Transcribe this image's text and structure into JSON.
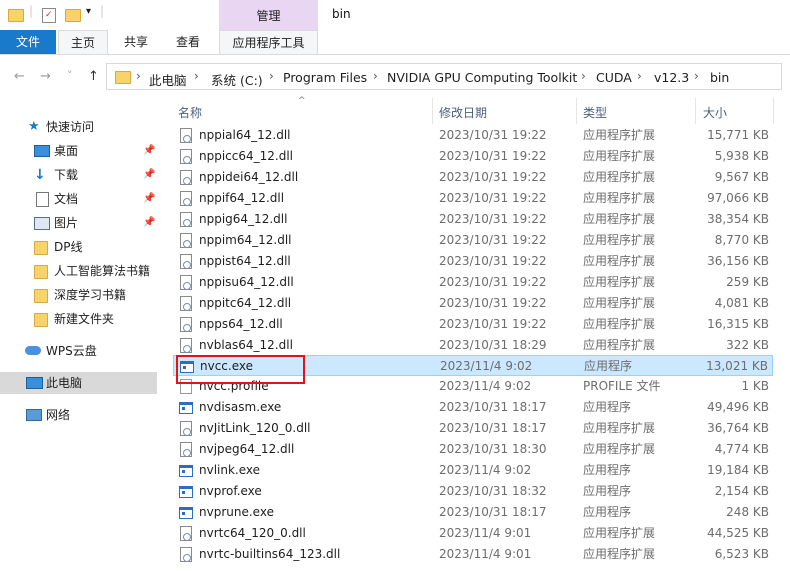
{
  "window": {
    "title": "bin"
  },
  "ribbon": {
    "context_tab": "管理",
    "tabs": {
      "file": "文件",
      "home": "主页",
      "share": "共享",
      "view": "查看",
      "app_tools": "应用程序工具"
    }
  },
  "nav": {
    "back": "←",
    "forward": "→",
    "recent": "˅",
    "up": "↑",
    "breadcrumbs": [
      "此电脑",
      "系统 (C:)",
      "Program Files",
      "NVIDIA GPU Computing Toolkit",
      "CUDA",
      "v12.3",
      "bin"
    ],
    "separator": "›"
  },
  "sidebar": {
    "quick_access": "快速访问",
    "items": [
      {
        "label": "桌面",
        "pinned": true
      },
      {
        "label": "下载",
        "pinned": true
      },
      {
        "label": "文档",
        "pinned": true
      },
      {
        "label": "图片",
        "pinned": true
      },
      {
        "label": "DP线",
        "pinned": false
      },
      {
        "label": "人工智能算法书籍",
        "pinned": false
      },
      {
        "label": "深度学习书籍",
        "pinned": false
      },
      {
        "label": "新建文件夹",
        "pinned": false
      }
    ],
    "wps": "WPS云盘",
    "this_pc": "此电脑",
    "network": "网络",
    "pin_glyph": "📌"
  },
  "columns": {
    "name": "名称",
    "date": "修改日期",
    "type": "类型",
    "size": "大小",
    "sort_glyph": "^"
  },
  "files": [
    {
      "name": "nppial64_12.dll",
      "date": "2023/10/31 19:22",
      "type": "应用程序扩展",
      "size": "15,771 KB",
      "icon": "dll"
    },
    {
      "name": "nppicc64_12.dll",
      "date": "2023/10/31 19:22",
      "type": "应用程序扩展",
      "size": "5,938 KB",
      "icon": "dll"
    },
    {
      "name": "nppidei64_12.dll",
      "date": "2023/10/31 19:22",
      "type": "应用程序扩展",
      "size": "9,567 KB",
      "icon": "dll"
    },
    {
      "name": "nppif64_12.dll",
      "date": "2023/10/31 19:22",
      "type": "应用程序扩展",
      "size": "97,066 KB",
      "icon": "dll"
    },
    {
      "name": "nppig64_12.dll",
      "date": "2023/10/31 19:22",
      "type": "应用程序扩展",
      "size": "38,354 KB",
      "icon": "dll"
    },
    {
      "name": "nppim64_12.dll",
      "date": "2023/10/31 19:22",
      "type": "应用程序扩展",
      "size": "8,770 KB",
      "icon": "dll"
    },
    {
      "name": "nppist64_12.dll",
      "date": "2023/10/31 19:22",
      "type": "应用程序扩展",
      "size": "36,156 KB",
      "icon": "dll"
    },
    {
      "name": "nppisu64_12.dll",
      "date": "2023/10/31 19:22",
      "type": "应用程序扩展",
      "size": "259 KB",
      "icon": "dll"
    },
    {
      "name": "nppitc64_12.dll",
      "date": "2023/10/31 19:22",
      "type": "应用程序扩展",
      "size": "4,081 KB",
      "icon": "dll"
    },
    {
      "name": "npps64_12.dll",
      "date": "2023/10/31 19:22",
      "type": "应用程序扩展",
      "size": "16,315 KB",
      "icon": "dll"
    },
    {
      "name": "nvblas64_12.dll",
      "date": "2023/10/31 18:29",
      "type": "应用程序扩展",
      "size": "322 KB",
      "icon": "dll"
    },
    {
      "name": "nvcc.exe",
      "date": "2023/11/4 9:02",
      "type": "应用程序",
      "size": "13,021 KB",
      "icon": "exe",
      "selected": true
    },
    {
      "name": "nvcc.profile",
      "date": "2023/11/4 9:02",
      "type": "PROFILE 文件",
      "size": "1 KB",
      "icon": "file"
    },
    {
      "name": "nvdisasm.exe",
      "date": "2023/10/31 18:17",
      "type": "应用程序",
      "size": "49,496 KB",
      "icon": "exe"
    },
    {
      "name": "nvJitLink_120_0.dll",
      "date": "2023/10/31 18:17",
      "type": "应用程序扩展",
      "size": "36,764 KB",
      "icon": "dll"
    },
    {
      "name": "nvjpeg64_12.dll",
      "date": "2023/10/31 18:30",
      "type": "应用程序扩展",
      "size": "4,774 KB",
      "icon": "dll"
    },
    {
      "name": "nvlink.exe",
      "date": "2023/11/4 9:02",
      "type": "应用程序",
      "size": "19,184 KB",
      "icon": "exe"
    },
    {
      "name": "nvprof.exe",
      "date": "2023/10/31 18:32",
      "type": "应用程序",
      "size": "2,154 KB",
      "icon": "exe"
    },
    {
      "name": "nvprune.exe",
      "date": "2023/10/31 18:17",
      "type": "应用程序",
      "size": "248 KB",
      "icon": "exe"
    },
    {
      "name": "nvrtc64_120_0.dll",
      "date": "2023/11/4 9:01",
      "type": "应用程序扩展",
      "size": "44,525 KB",
      "icon": "dll"
    },
    {
      "name": "nvrtc-builtins64_123.dll",
      "date": "2023/11/4 9:01",
      "type": "应用程序扩展",
      "size": "6,523 KB",
      "icon": "dll"
    }
  ],
  "colors": {
    "accent": "#1979ca",
    "selection": "#cce8ff",
    "annotation": "#e0141b",
    "context_tab": "#e9d6f2"
  }
}
